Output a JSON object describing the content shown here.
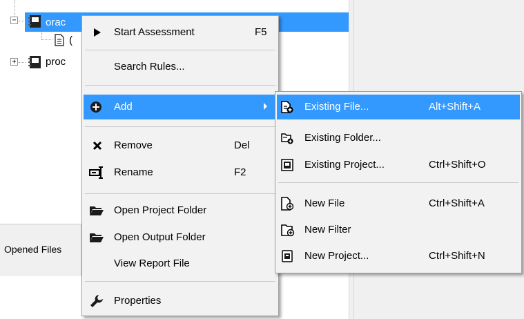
{
  "tree": {
    "items": [
      {
        "label": "orac",
        "expander": "−"
      },
      {
        "label": "("
      },
      {
        "label": "proc",
        "expander": "+"
      }
    ],
    "opened_files_tab": "Opened Files"
  },
  "context_menu": {
    "start": {
      "label": "Start Assessment",
      "shortcut": "F5"
    },
    "search": {
      "label": "Search Rules..."
    },
    "add": {
      "label": "Add"
    },
    "remove": {
      "label": "Remove",
      "shortcut": "Del"
    },
    "rename": {
      "label": "Rename",
      "shortcut": "F2"
    },
    "open_project_folder": {
      "label": "Open Project Folder"
    },
    "open_output_folder": {
      "label": "Open Output Folder"
    },
    "view_report": {
      "label": "View Report File"
    },
    "properties": {
      "label": "Properties"
    }
  },
  "add_submenu": {
    "existing_file": {
      "label": "Existing File...",
      "shortcut": "Alt+Shift+A"
    },
    "existing_folder": {
      "label": "Existing Folder..."
    },
    "existing_project": {
      "label": "Existing Project...",
      "shortcut": "Ctrl+Shift+O"
    },
    "new_file": {
      "label": "New File",
      "shortcut": "Ctrl+Shift+A"
    },
    "new_filter": {
      "label": "New Filter"
    },
    "new_project": {
      "label": "New Project...",
      "shortcut": "Ctrl+Shift+N"
    }
  },
  "colors": {
    "highlight": "#3399ff",
    "menu_bg": "#f2f2f2"
  }
}
